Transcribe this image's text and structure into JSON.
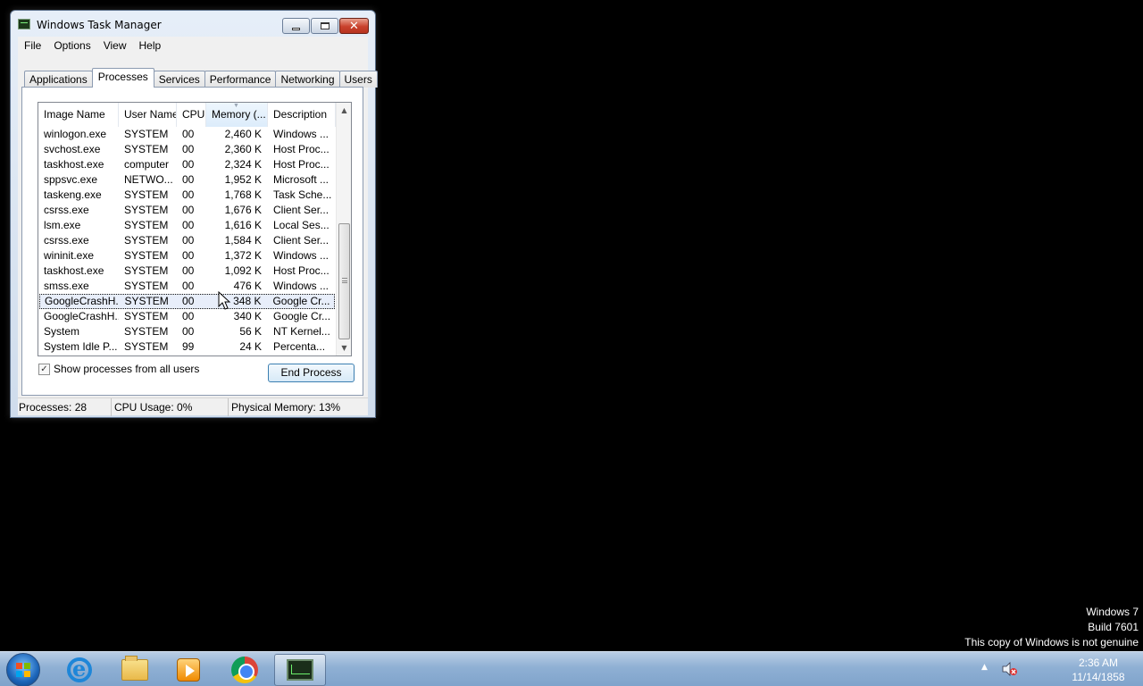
{
  "window": {
    "title": "Windows Task Manager",
    "menu": [
      "File",
      "Options",
      "View",
      "Help"
    ],
    "tabs": [
      "Applications",
      "Processes",
      "Services",
      "Performance",
      "Networking",
      "Users"
    ],
    "active_tab": "Processes"
  },
  "process_table": {
    "columns": [
      "Image Name",
      "User Name",
      "CPU",
      "Memory (...",
      "Description"
    ],
    "sorted_column": "Memory (...",
    "rows": [
      {
        "name": "winlogon.exe",
        "user": "SYSTEM",
        "cpu": "00",
        "mem": "2,460 K",
        "desc": "Windows ..."
      },
      {
        "name": "svchost.exe",
        "user": "SYSTEM",
        "cpu": "00",
        "mem": "2,360 K",
        "desc": "Host Proc..."
      },
      {
        "name": "taskhost.exe",
        "user": "computer",
        "cpu": "00",
        "mem": "2,324 K",
        "desc": "Host Proc..."
      },
      {
        "name": "sppsvc.exe",
        "user": "NETWO...",
        "cpu": "00",
        "mem": "1,952 K",
        "desc": "Microsoft ..."
      },
      {
        "name": "taskeng.exe",
        "user": "SYSTEM",
        "cpu": "00",
        "mem": "1,768 K",
        "desc": "Task Sche..."
      },
      {
        "name": "csrss.exe",
        "user": "SYSTEM",
        "cpu": "00",
        "mem": "1,676 K",
        "desc": "Client Ser..."
      },
      {
        "name": "lsm.exe",
        "user": "SYSTEM",
        "cpu": "00",
        "mem": "1,616 K",
        "desc": "Local Ses..."
      },
      {
        "name": "csrss.exe",
        "user": "SYSTEM",
        "cpu": "00",
        "mem": "1,584 K",
        "desc": "Client Ser..."
      },
      {
        "name": "wininit.exe",
        "user": "SYSTEM",
        "cpu": "00",
        "mem": "1,372 K",
        "desc": "Windows ..."
      },
      {
        "name": "taskhost.exe",
        "user": "SYSTEM",
        "cpu": "00",
        "mem": "1,092 K",
        "desc": "Host Proc..."
      },
      {
        "name": "smss.exe",
        "user": "SYSTEM",
        "cpu": "00",
        "mem": "476 K",
        "desc": "Windows ..."
      },
      {
        "name": "GoogleCrashH...",
        "user": "SYSTEM",
        "cpu": "00",
        "mem": "348 K",
        "desc": "Google Cr...",
        "selected": true
      },
      {
        "name": "GoogleCrashH...",
        "user": "SYSTEM",
        "cpu": "00",
        "mem": "340 K",
        "desc": "Google Cr..."
      },
      {
        "name": "System",
        "user": "SYSTEM",
        "cpu": "00",
        "mem": "56 K",
        "desc": "NT Kernel..."
      },
      {
        "name": "System Idle P...",
        "user": "SYSTEM",
        "cpu": "99",
        "mem": "24 K",
        "desc": "Percenta..."
      }
    ]
  },
  "show_all_users": {
    "label": "Show processes from all users",
    "checked": true,
    "mark": "✓"
  },
  "end_process_label": "End Process",
  "status": {
    "processes": "Processes: 28",
    "cpu": "CPU Usage: 0%",
    "memory": "Physical Memory: 13%"
  },
  "watermark": {
    "line1": "Windows 7",
    "line2": "Build 7601",
    "line3": "This copy of Windows is not genuine"
  },
  "taskbar": {
    "apps": [
      "start-icon",
      "internet-explorer-icon",
      "windows-explorer-icon",
      "media-player-icon",
      "chrome-icon",
      "task-manager-icon"
    ],
    "clock_time": "2:36 AM",
    "clock_date": "11/14/1858"
  }
}
